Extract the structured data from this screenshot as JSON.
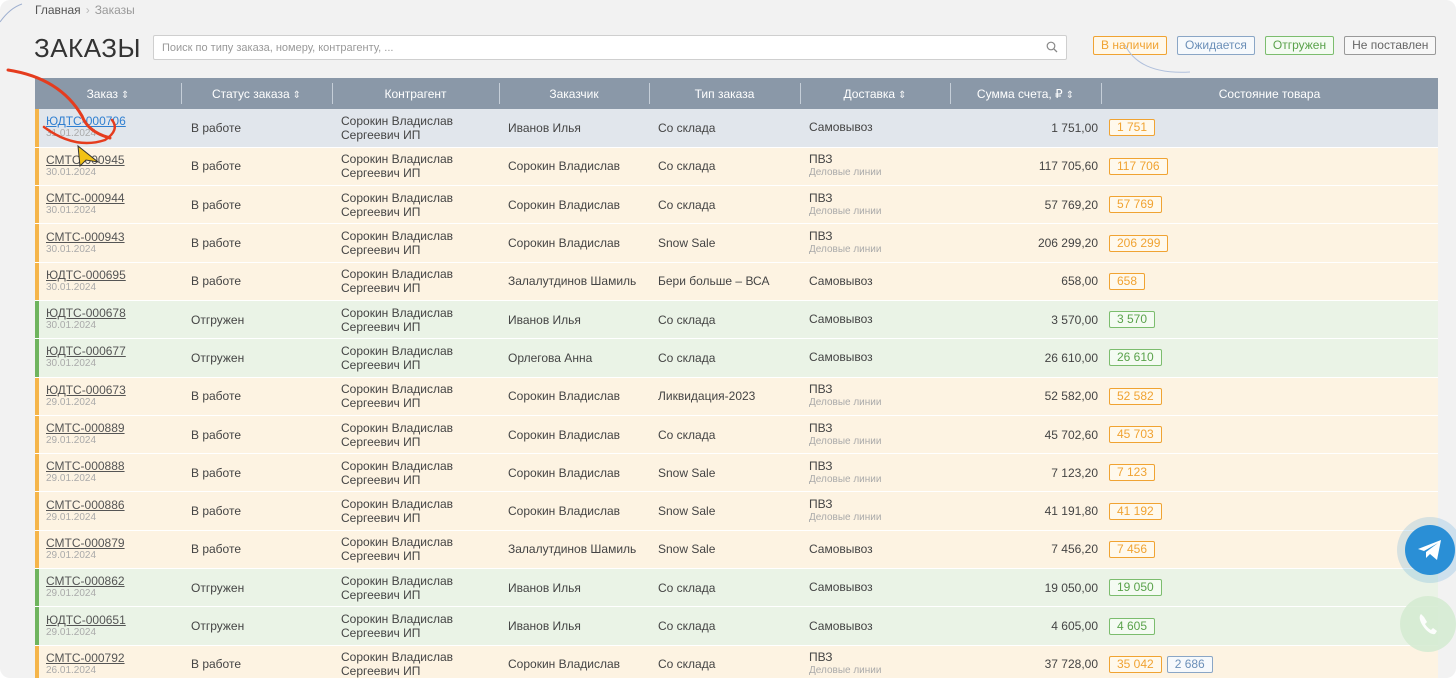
{
  "breadcrumb": {
    "home": "Главная",
    "current": "Заказы"
  },
  "page_title": "ЗАКАЗЫ",
  "search": {
    "placeholder": "Поиск по типу заказа, номеру, контрагенту, ..."
  },
  "filters": [
    "В наличии",
    "Ожидается",
    "Отгружен",
    "Не поставлен"
  ],
  "columns": {
    "order": "Заказ",
    "status": "Статус заказа",
    "counterparty": "Контрагент",
    "customer": "Заказчик",
    "order_type": "Тип заказа",
    "delivery": "Доставка",
    "sum": "Сумма счета, ₽",
    "goods_state": "Состояние товара"
  },
  "rows": [
    {
      "num": "ЮДТС-000706",
      "date": "31.01.2024",
      "status": "В работе",
      "contr1": "Сорокин Владислав",
      "contr2": "Сергеевич ИП",
      "customer": "Иванов Илья",
      "type": "Со склада",
      "delivery": "Самовывоз",
      "delivery_sub": "",
      "sum": "1 751,00",
      "badges": [
        {
          "text": "1 751",
          "color": "orange"
        }
      ],
      "kind": "selected"
    },
    {
      "num": "СМТС-000945",
      "date": "30.01.2024",
      "status": "В работе",
      "contr1": "Сорокин Владислав",
      "contr2": "Сергеевич ИП",
      "customer": "Сорокин Владислав",
      "type": "Со склада",
      "delivery": "ПВЗ",
      "delivery_sub": "Деловые линии",
      "sum": "117 705,60",
      "badges": [
        {
          "text": "117 706",
          "color": "orange"
        }
      ],
      "kind": "work"
    },
    {
      "num": "СМТС-000944",
      "date": "30.01.2024",
      "status": "В работе",
      "contr1": "Сорокин Владислав",
      "contr2": "Сергеевич ИП",
      "customer": "Сорокин Владислав",
      "type": "Со склада",
      "delivery": "ПВЗ",
      "delivery_sub": "Деловые линии",
      "sum": "57 769,20",
      "badges": [
        {
          "text": "57 769",
          "color": "orange"
        }
      ],
      "kind": "work"
    },
    {
      "num": "СМТС-000943",
      "date": "30.01.2024",
      "status": "В работе",
      "contr1": "Сорокин Владислав",
      "contr2": "Сергеевич ИП",
      "customer": "Сорокин Владислав",
      "type": "Snow Sale",
      "delivery": "ПВЗ",
      "delivery_sub": "Деловые линии",
      "sum": "206 299,20",
      "badges": [
        {
          "text": "206 299",
          "color": "orange"
        }
      ],
      "kind": "work"
    },
    {
      "num": "ЮДТС-000695",
      "date": "30.01.2024",
      "status": "В работе",
      "contr1": "Сорокин Владислав",
      "contr2": "Сергеевич ИП",
      "customer": "Залалутдинов Шамиль",
      "type": "Бери больше – ВСА",
      "delivery": "Самовывоз",
      "delivery_sub": "",
      "sum": "658,00",
      "badges": [
        {
          "text": "658",
          "color": "orange"
        }
      ],
      "kind": "work"
    },
    {
      "num": "ЮДТС-000678",
      "date": "30.01.2024",
      "status": "Отгружен",
      "contr1": "Сорокин Владислав",
      "contr2": "Сергеевич ИП",
      "customer": "Иванов Илья",
      "type": "Со склада",
      "delivery": "Самовывоз",
      "delivery_sub": "",
      "sum": "3 570,00",
      "badges": [
        {
          "text": "3 570",
          "color": "green"
        }
      ],
      "kind": "ship"
    },
    {
      "num": "ЮДТС-000677",
      "date": "30.01.2024",
      "status": "Отгружен",
      "contr1": "Сорокин Владислав",
      "contr2": "Сергеевич ИП",
      "customer": "Орлегова Анна",
      "type": "Со склада",
      "delivery": "Самовывоз",
      "delivery_sub": "",
      "sum": "26 610,00",
      "badges": [
        {
          "text": "26 610",
          "color": "green"
        }
      ],
      "kind": "ship"
    },
    {
      "num": "ЮДТС-000673",
      "date": "29.01.2024",
      "status": "В работе",
      "contr1": "Сорокин Владислав",
      "contr2": "Сергеевич ИП",
      "customer": "Сорокин Владислав",
      "type": "Ликвидация-2023",
      "delivery": "ПВЗ",
      "delivery_sub": "Деловые линии",
      "sum": "52 582,00",
      "badges": [
        {
          "text": "52 582",
          "color": "orange"
        }
      ],
      "kind": "work"
    },
    {
      "num": "СМТС-000889",
      "date": "29.01.2024",
      "status": "В работе",
      "contr1": "Сорокин Владислав",
      "contr2": "Сергеевич ИП",
      "customer": "Сорокин Владислав",
      "type": "Со склада",
      "delivery": "ПВЗ",
      "delivery_sub": "Деловые линии",
      "sum": "45 702,60",
      "badges": [
        {
          "text": "45 703",
          "color": "orange"
        }
      ],
      "kind": "work"
    },
    {
      "num": "СМТС-000888",
      "date": "29.01.2024",
      "status": "В работе",
      "contr1": "Сорокин Владислав",
      "contr2": "Сергеевич ИП",
      "customer": "Сорокин Владислав",
      "type": "Snow Sale",
      "delivery": "ПВЗ",
      "delivery_sub": "Деловые линии",
      "sum": "7 123,20",
      "badges": [
        {
          "text": "7 123",
          "color": "orange"
        }
      ],
      "kind": "work"
    },
    {
      "num": "СМТС-000886",
      "date": "29.01.2024",
      "status": "В работе",
      "contr1": "Сорокин Владислав",
      "contr2": "Сергеевич ИП",
      "customer": "Сорокин Владислав",
      "type": "Snow Sale",
      "delivery": "ПВЗ",
      "delivery_sub": "Деловые линии",
      "sum": "41 191,80",
      "badges": [
        {
          "text": "41 192",
          "color": "orange"
        }
      ],
      "kind": "work"
    },
    {
      "num": "СМТС-000879",
      "date": "29.01.2024",
      "status": "В работе",
      "contr1": "Сорокин Владислав",
      "contr2": "Сергеевич ИП",
      "customer": "Залалутдинов Шамиль",
      "type": "Snow Sale",
      "delivery": "Самовывоз",
      "delivery_sub": "",
      "sum": "7 456,20",
      "badges": [
        {
          "text": "7 456",
          "color": "orange"
        }
      ],
      "kind": "work"
    },
    {
      "num": "СМТС-000862",
      "date": "29.01.2024",
      "status": "Отгружен",
      "contr1": "Сорокин Владислав",
      "contr2": "Сергеевич ИП",
      "customer": "Иванов Илья",
      "type": "Со склада",
      "delivery": "Самовывоз",
      "delivery_sub": "",
      "sum": "19 050,00",
      "badges": [
        {
          "text": "19 050",
          "color": "green"
        }
      ],
      "kind": "ship"
    },
    {
      "num": "ЮДТС-000651",
      "date": "29.01.2024",
      "status": "Отгружен",
      "contr1": "Сорокин Владислав",
      "contr2": "Сергеевич ИП",
      "customer": "Иванов Илья",
      "type": "Со склада",
      "delivery": "Самовывоз",
      "delivery_sub": "",
      "sum": "4 605,00",
      "badges": [
        {
          "text": "4 605",
          "color": "green"
        }
      ],
      "kind": "ship"
    },
    {
      "num": "СМТС-000792",
      "date": "26.01.2024",
      "status": "В работе",
      "contr1": "Сорокин Владислав",
      "contr2": "Сергеевич ИП",
      "customer": "Сорокин Владислав",
      "type": "Со склада",
      "delivery": "ПВЗ",
      "delivery_sub": "Деловые линии",
      "sum": "37 728,00",
      "badges": [
        {
          "text": "35 042",
          "color": "orange"
        },
        {
          "text": "2 686",
          "color": "blue"
        }
      ],
      "kind": "work"
    }
  ],
  "icons": {
    "search": "search-icon",
    "sort": "sort-icon",
    "telegram": "telegram-icon",
    "phone": "phone-icon"
  },
  "colors": {
    "header": "#8a98a8",
    "work_row": "#fdf3e2",
    "ship_row": "#eaf3e6",
    "accent_orange": "#f0a332",
    "accent_green": "#5aa24b",
    "telegram": "#2a8fd6"
  }
}
